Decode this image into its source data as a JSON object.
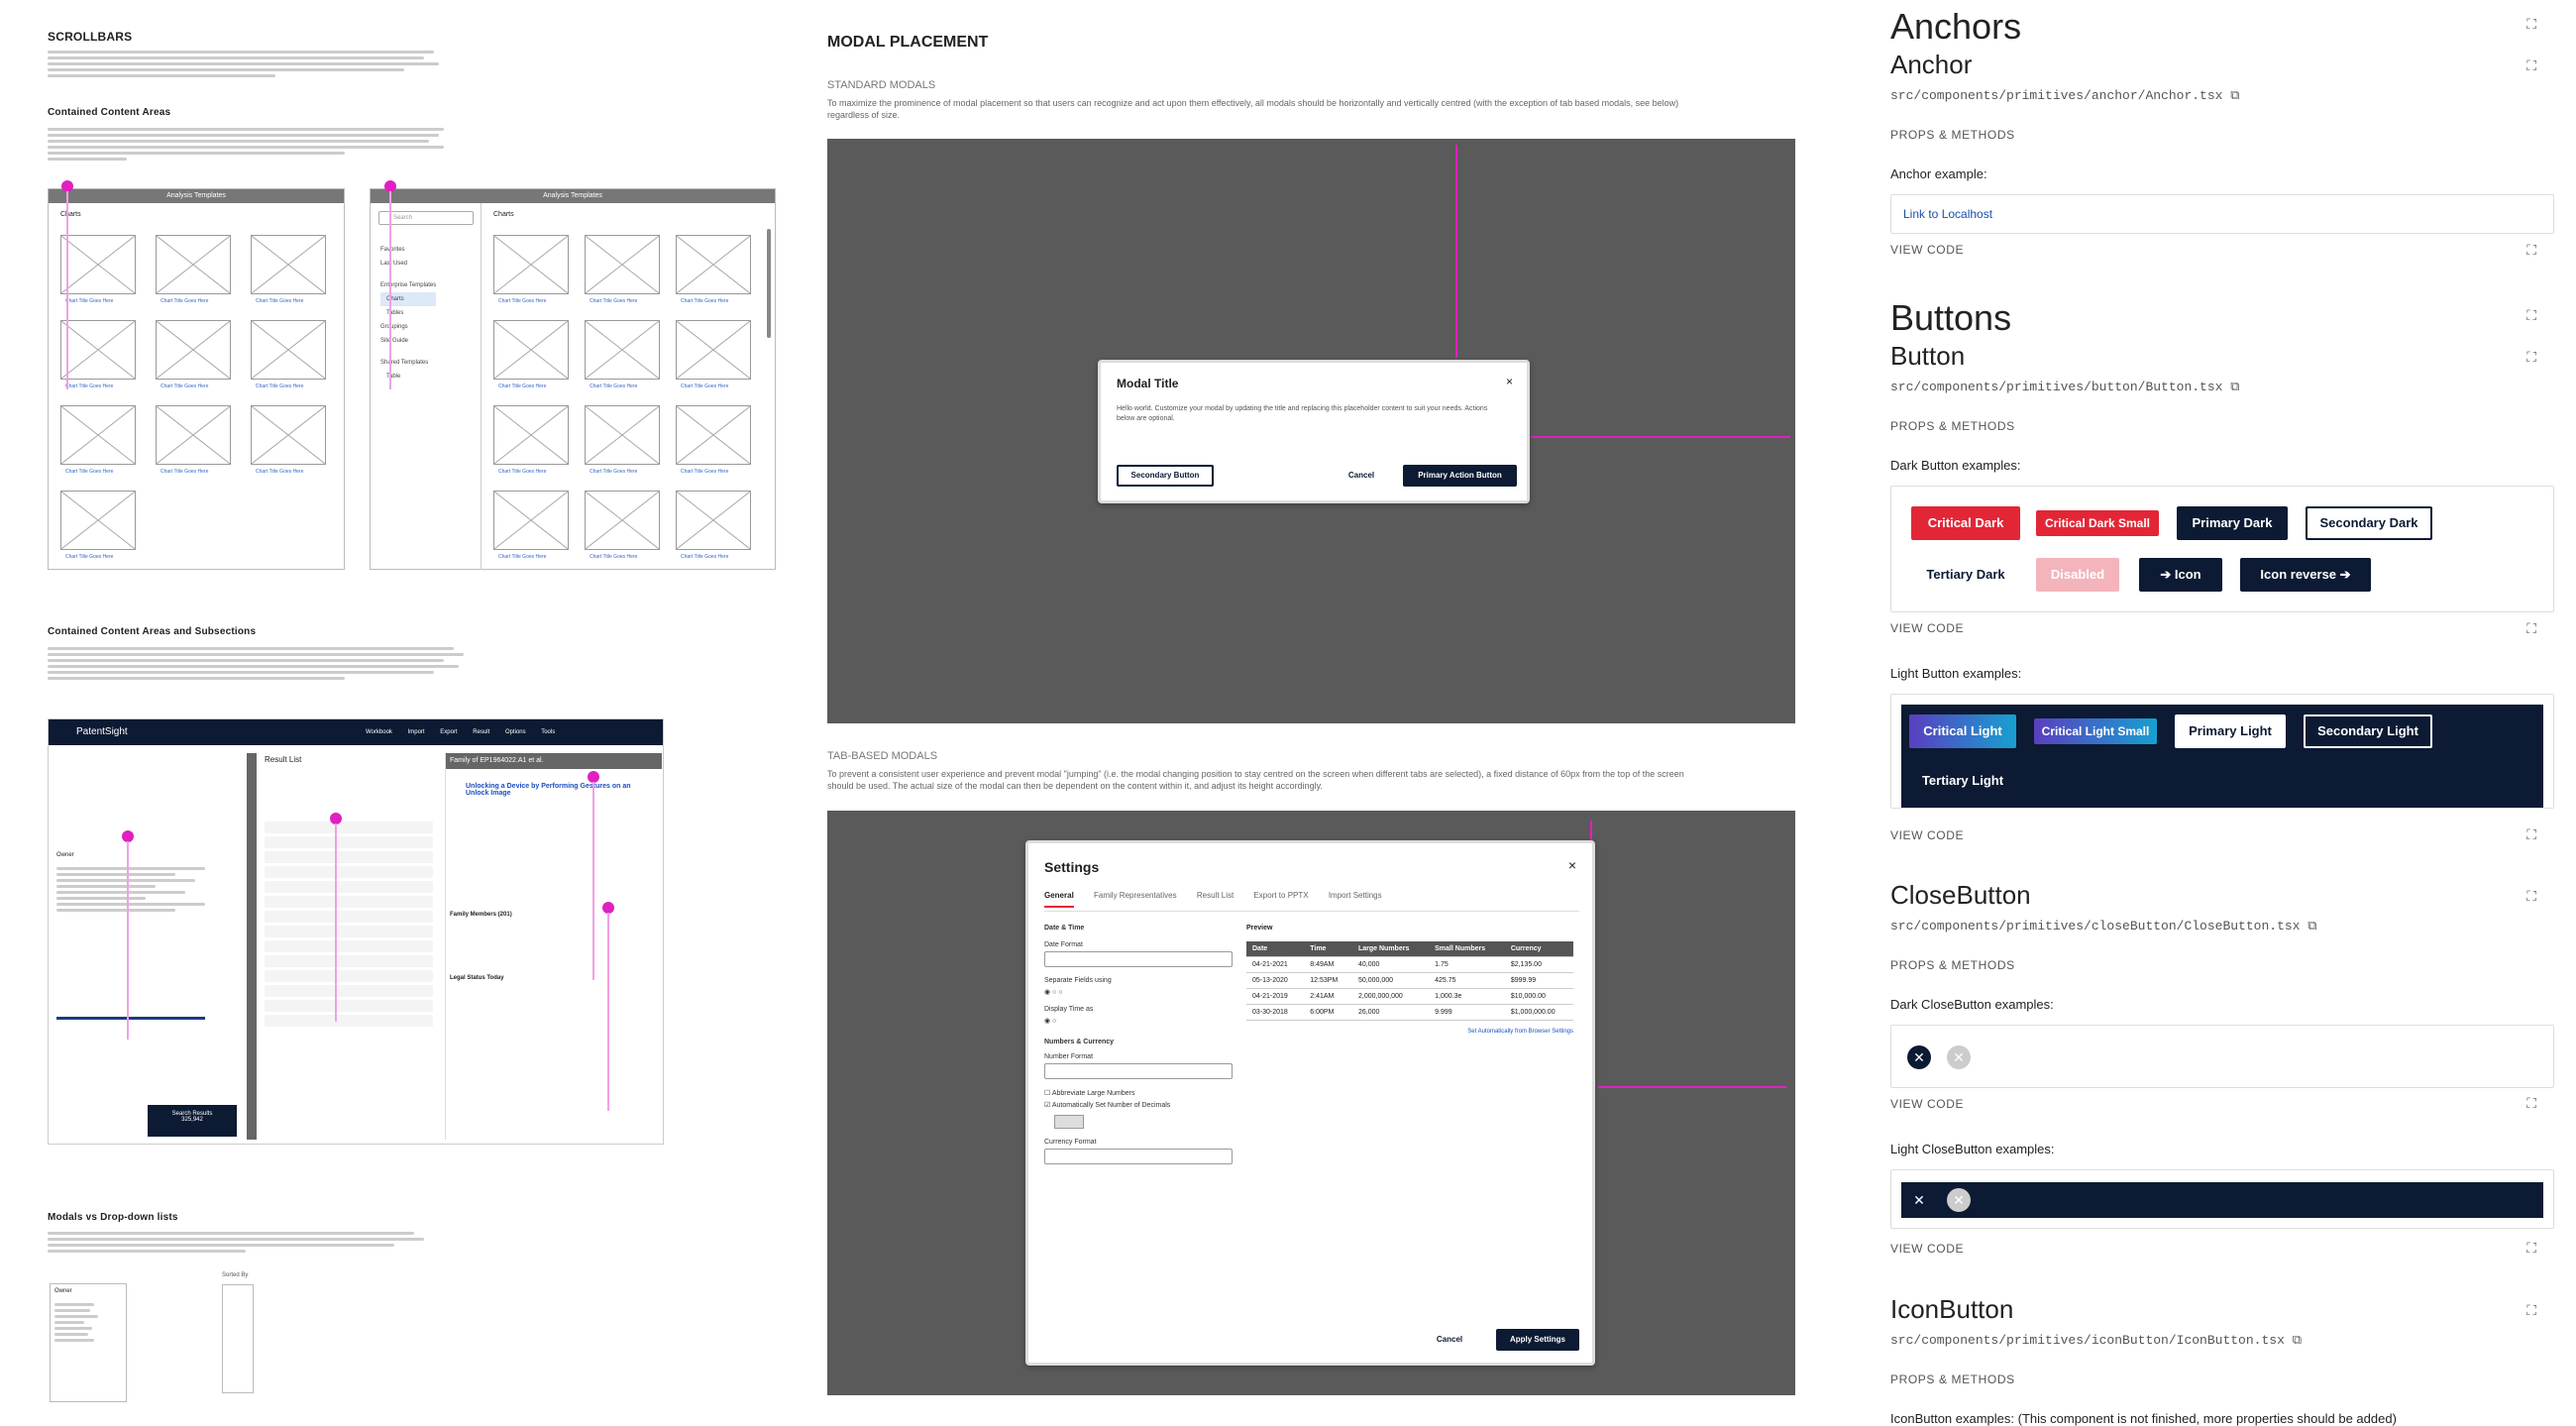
{
  "left": {
    "scrollbars_title": "SCROLLBARS",
    "contained_title": "Contained Content Areas",
    "subsections_title": "Contained Content Areas and Subsections",
    "modals_dropdown_title": "Modals vs Drop-down lists",
    "analysis_title_1": "Analysis Templates",
    "analysis_title_2": "Analysis Templates",
    "charts_label_1": "Charts",
    "charts_label_2": "Charts",
    "search_placeholder": "Search",
    "side_items": [
      "Favorites",
      "Last Used",
      "Enterprise Templates",
      "Charts",
      "Tables",
      "Groupings",
      "Site Guide",
      "Shared Templates",
      "Table"
    ],
    "chart_caption": "Chart Title Goes Here",
    "app_name": "PatentSight",
    "nav_items": [
      "Workbook",
      "Import",
      "Export",
      "Result",
      "Options",
      "Tools"
    ],
    "result_list_title": "Result List",
    "family_title": "Family of EP1964022.A1 et al.",
    "family_link": "Unlocking a Device by Performing Gestures on an Unlock Image",
    "family_members_label": "Family Members (201)",
    "legal_status_label": "Legal Status Today",
    "search_results_label": "Search Results",
    "search_results_count": "325,942",
    "filters_label": "Owner",
    "dropdown_label": "Sorted By"
  },
  "middle": {
    "title": "MODAL PLACEMENT",
    "standard_label": "STANDARD MODALS",
    "standard_desc": "To maximize the prominence of modal placement so that users can recognize and act upon them effectively, all modals should be horizontally and vertically centred (with the exception of tab based modals, see below) regardless of size.",
    "modal_title": "Modal Title",
    "modal_body": "Hello world. Customize your modal by updating the title and replacing this placeholder content to suit your needs. Actions below are optional.",
    "secondary_button": "Secondary Button",
    "cancel": "Cancel",
    "primary_button": "Primary Action Button",
    "tab_label": "TAB-BASED MODALS",
    "tab_desc": "To prevent a consistent user experience and prevent modal \"jumping\" (i.e. the modal changing position to stay centred on the screen when different tabs are selected), a fixed distance of 60px from the top of the screen should be used. The actual size of the modal can then be dependent on the content within it, and adjust its height accordingly.",
    "settings_title": "Settings",
    "tabs": [
      "General",
      "Family Representatives",
      "Result List",
      "Export to PPTX",
      "Import Settings"
    ],
    "date_time": "Date & Time",
    "date_format": "Date Format",
    "separate_fields": "Separate Fields using",
    "display_time": "Display Time as",
    "numbers_currency": "Numbers & Currency",
    "number_format": "Number Format",
    "abbreviate": "Abbreviate Large Numbers",
    "auto_decimals": "Automatically Set Number of Decimals",
    "currency_format": "Currency Format",
    "preview": "Preview",
    "preview_headers": [
      "Date",
      "Time",
      "Large Numbers",
      "Small Numbers",
      "Currency"
    ],
    "preview_rows": [
      [
        "04-21-2021",
        "8:49AM",
        "40,000",
        "1.75",
        "$2,135.00"
      ],
      [
        "05-13-2020",
        "12:53PM",
        "50,000,000",
        "425.75",
        "$999.99"
      ],
      [
        "04-21-2019",
        "2:41AM",
        "2,000,000,000",
        "1,000.3e",
        "$10,000.00"
      ],
      [
        "03-30-2018",
        "6:00PM",
        "26,000",
        "9.999",
        "$1,000,000.00"
      ]
    ],
    "set_auto": "Set Automatically from Browser Settings",
    "settings_cancel": "Cancel",
    "apply_settings": "Apply Settings"
  },
  "right": {
    "anchors_title": "Anchors",
    "anchor_sub": "Anchor",
    "anchor_path": "src/components/primitives/anchor/Anchor.tsx",
    "props_methods": "PROPS & METHODS",
    "anchor_example_label": "Anchor example:",
    "anchor_link": "Link to Localhost",
    "view_code": "VIEW CODE",
    "buttons_title": "Buttons",
    "button_sub": "Button",
    "button_path": "src/components/primitives/button/Button.tsx",
    "dark_examples_label": "Dark Button examples:",
    "dark_buttons": [
      "Critical Dark",
      "Critical Dark Small",
      "Primary Dark",
      "Secondary Dark",
      "Tertiary Dark",
      "Disabled",
      "Icon",
      "Icon reverse"
    ],
    "light_examples_label": "Light Button examples:",
    "light_buttons": [
      "Critical Light",
      "Critical Light Small",
      "Primary Light",
      "Secondary Light",
      "Tertiary Light"
    ],
    "close_title": "CloseButton",
    "close_path": "src/components/primitives/closeButton/CloseButton.tsx",
    "dark_close_label": "Dark CloseButton examples:",
    "light_close_label": "Light CloseButton examples:",
    "icon_title": "IconButton",
    "icon_path": "src/components/primitives/iconButton/IconButton.tsx",
    "icon_examples_label": "IconButton examples: (This component is not finished, more properties should be added)"
  },
  "colors": {
    "critical": "#e32636",
    "navy": "#0c1a33",
    "magenta": "#e020c0",
    "disabled_pink": "#f4b4bc",
    "gradient_a": "#5a3fc0",
    "gradient_b": "#17a0d0"
  }
}
